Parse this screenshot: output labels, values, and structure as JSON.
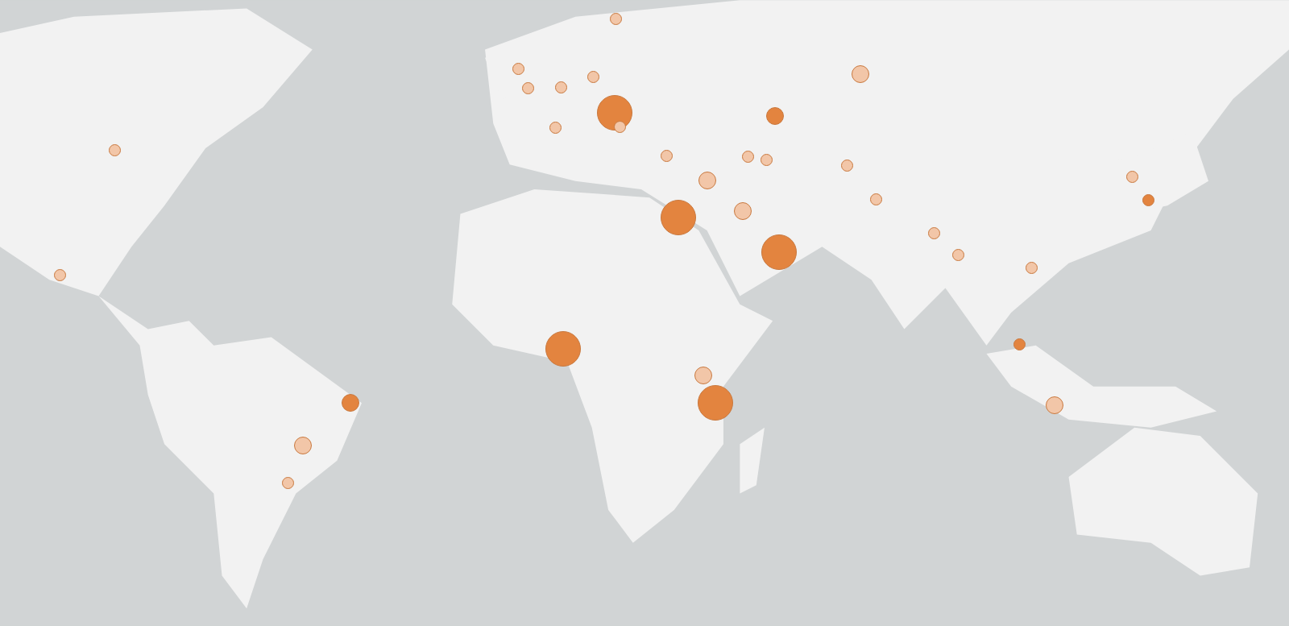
{
  "map": {
    "kind": "picture",
    "markers": [
      {
        "kind": "large",
        "color": "#e3843f"
      },
      {
        "kind": "large",
        "color": "#e3843f"
      },
      {
        "kind": "large",
        "color": "#e3843f"
      },
      {
        "kind": "large",
        "color": "#e3843f"
      },
      {
        "kind": "large",
        "color": "#e3843f"
      },
      {
        "kind": "medium",
        "color": "#e3843f"
      },
      {
        "kind": "medium",
        "color": "#e3843f"
      },
      {
        "kind": "medium",
        "color": "#f2c6a8"
      },
      {
        "kind": "medium",
        "color": "#f2c6a8"
      },
      {
        "kind": "medium",
        "color": "#f2c6a8"
      },
      {
        "kind": "medium",
        "color": "#f2c6a8"
      },
      {
        "kind": "medium",
        "color": "#f2c6a8"
      },
      {
        "kind": "medium",
        "color": "#f2c6a8"
      },
      {
        "kind": "small",
        "color": "#f2c6a8"
      },
      {
        "kind": "small",
        "color": "#f2c6a8"
      },
      {
        "kind": "small",
        "color": "#f2c6a8"
      },
      {
        "kind": "small",
        "color": "#f2c6a8"
      },
      {
        "kind": "small",
        "color": "#f2c6a8"
      },
      {
        "kind": "small",
        "color": "#f2c6a8"
      },
      {
        "kind": "small",
        "color": "#f2c6a8"
      },
      {
        "kind": "small",
        "color": "#f2c6a8"
      },
      {
        "kind": "small",
        "color": "#f2c6a8"
      },
      {
        "kind": "small",
        "color": "#f2c6a8"
      },
      {
        "kind": "small",
        "color": "#f2c6a8"
      },
      {
        "kind": "small",
        "color": "#f2c6a8"
      },
      {
        "kind": "small",
        "color": "#f2c6a8"
      },
      {
        "kind": "small",
        "color": "#f2c6a8"
      },
      {
        "kind": "small",
        "color": "#f2c6a8"
      },
      {
        "kind": "small",
        "color": "#f2c6a8"
      },
      {
        "kind": "small",
        "color": "#f2c6a8"
      },
      {
        "kind": "small",
        "color": "#f2c6a8"
      },
      {
        "kind": "small",
        "color": "#f2c6a8"
      },
      {
        "kind": "small",
        "color": "#e3843f"
      },
      {
        "kind": "small",
        "color": "#e3843f"
      }
    ]
  }
}
